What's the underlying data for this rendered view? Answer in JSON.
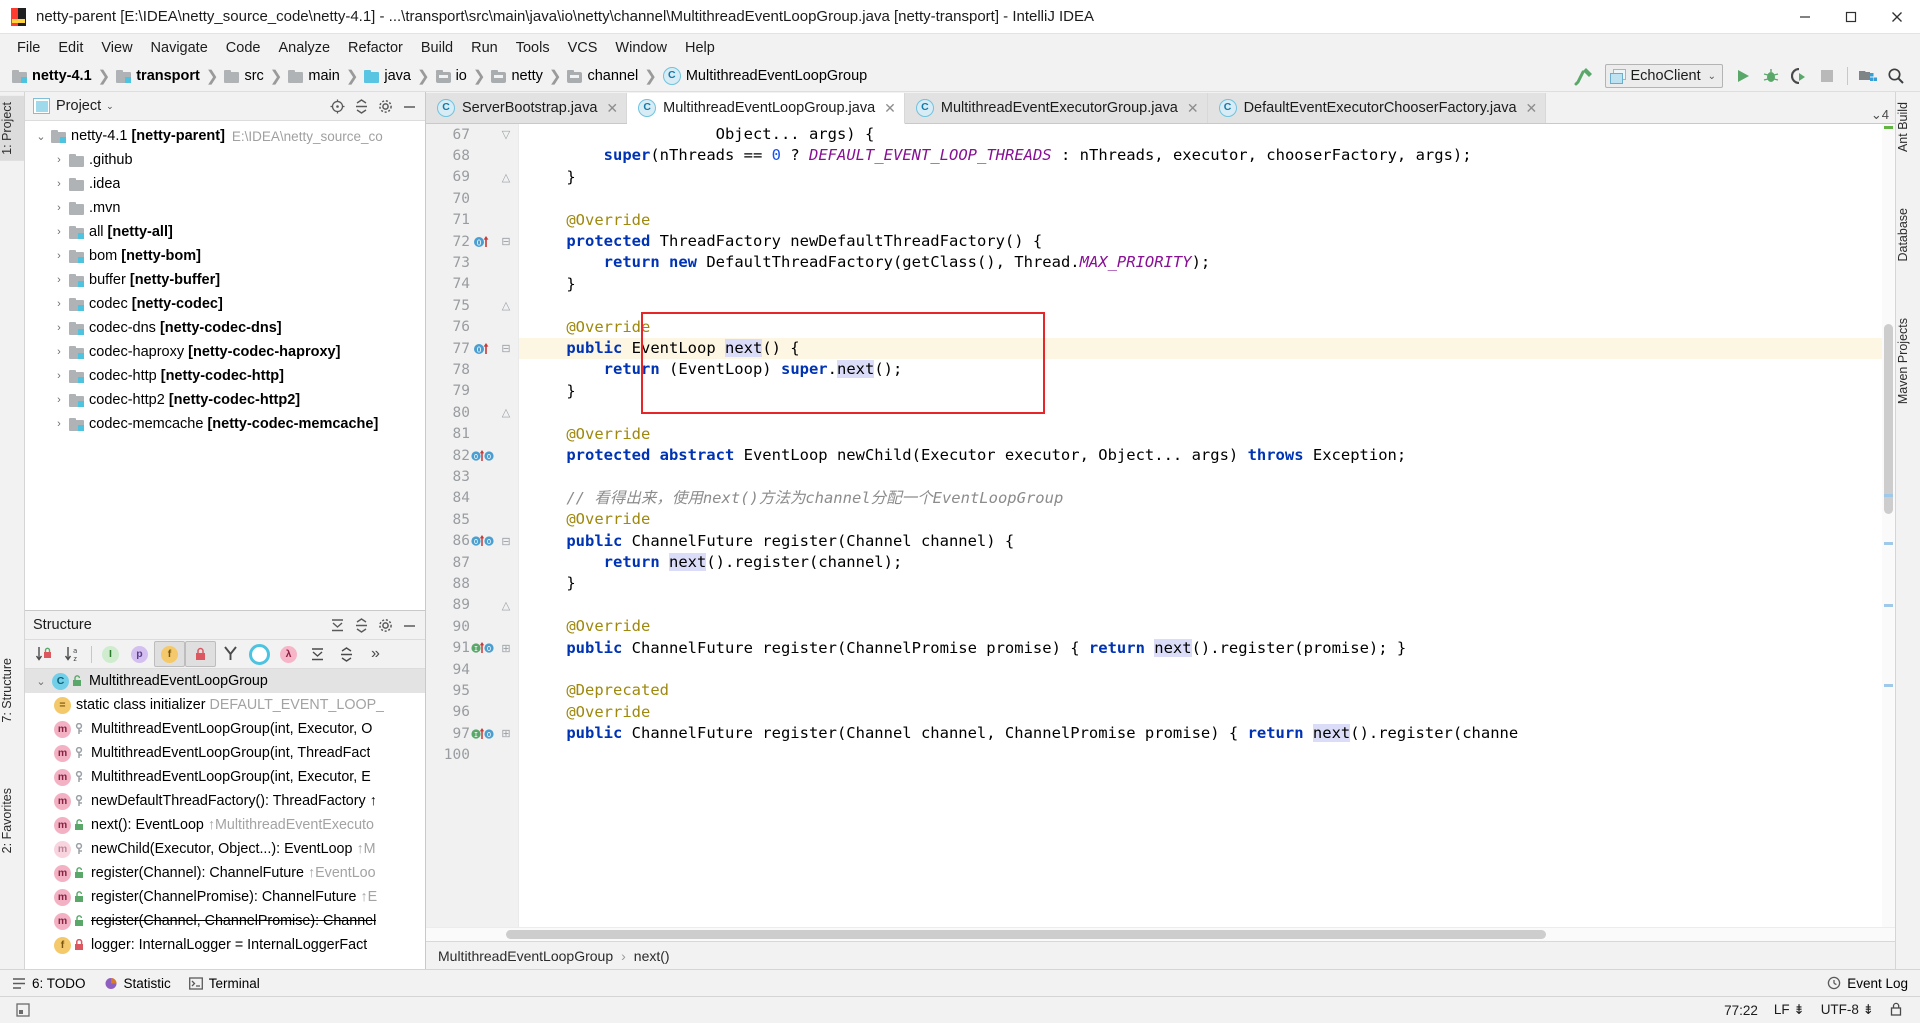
{
  "window": {
    "title": "netty-parent [E:\\IDEA\\netty_source_code\\netty-4.1] - ...\\transport\\src\\main\\java\\io\\netty\\channel\\MultithreadEventLoopGroup.java [netty-transport] - IntelliJ IDEA",
    "minimize": "–",
    "maximize": "□",
    "close": "✕"
  },
  "menu": [
    {
      "label": "File"
    },
    {
      "label": "Edit"
    },
    {
      "label": "View"
    },
    {
      "label": "Navigate"
    },
    {
      "label": "Code"
    },
    {
      "label": "Analyze"
    },
    {
      "label": "Refactor"
    },
    {
      "label": "Build"
    },
    {
      "label": "Run"
    },
    {
      "label": "Tools"
    },
    {
      "label": "VCS"
    },
    {
      "label": "Window"
    },
    {
      "label": "Help"
    }
  ],
  "breadcrumbs": [
    {
      "label": "netty-4.1",
      "icon": "module-folder-icon",
      "bold": true
    },
    {
      "label": "transport",
      "icon": "module-folder-icon",
      "bold": true
    },
    {
      "label": "src",
      "icon": "folder-icon",
      "bold": false
    },
    {
      "label": "main",
      "icon": "folder-icon",
      "bold": false
    },
    {
      "label": "java",
      "icon": "source-folder-icon",
      "bold": false
    },
    {
      "label": "io",
      "icon": "package-icon",
      "bold": false
    },
    {
      "label": "netty",
      "icon": "package-icon",
      "bold": false
    },
    {
      "label": "channel",
      "icon": "package-icon",
      "bold": false
    },
    {
      "label": "MultithreadEventLoopGroup",
      "icon": "class-icon",
      "bold": false
    }
  ],
  "toolbar": {
    "build_icon": "hammer-icon",
    "run_config": "EchoClient",
    "run_config_dropdown": "⌄",
    "run_icon": "run-icon",
    "debug_icon": "debug-icon",
    "run_coverage_icon": "run-with-coverage-icon",
    "stop_icon": "stop-icon",
    "project_structure_icon": "project-structure-icon",
    "search_icon": "search-everywhere-icon"
  },
  "left_rail": [
    {
      "label": "1: Project"
    },
    {
      "label": "7: Structure"
    },
    {
      "label": "2: Favorites"
    }
  ],
  "right_rail": [
    {
      "label": "Ant Build"
    },
    {
      "label": "Database"
    },
    {
      "label": "Maven Projects"
    }
  ],
  "project_panel": {
    "title": "Project",
    "caret": "⌄",
    "icons": [
      "target-icon",
      "collapse-all-icon",
      "settings-icon",
      "hide-icon"
    ],
    "tree": [
      {
        "arrow": "⌄",
        "icon": "module-folder-icon",
        "label": "netty-4.1",
        "bold_suffix": "[netty-parent]",
        "path": "E:\\IDEA\\netty_source_co",
        "indent": 0
      },
      {
        "arrow": "›",
        "icon": "folder-icon",
        "label": ".github",
        "bold_suffix": "",
        "path": "",
        "indent": 1
      },
      {
        "arrow": "›",
        "icon": "folder-icon",
        "label": ".idea",
        "bold_suffix": "",
        "path": "",
        "indent": 1
      },
      {
        "arrow": "›",
        "icon": "folder-icon",
        "label": ".mvn",
        "bold_suffix": "",
        "path": "",
        "indent": 1
      },
      {
        "arrow": "›",
        "icon": "module-folder-icon",
        "label": "all",
        "bold_suffix": "[netty-all]",
        "path": "",
        "indent": 1
      },
      {
        "arrow": "›",
        "icon": "module-folder-icon",
        "label": "bom",
        "bold_suffix": "[netty-bom]",
        "path": "",
        "indent": 1
      },
      {
        "arrow": "›",
        "icon": "module-folder-icon",
        "label": "buffer",
        "bold_suffix": "[netty-buffer]",
        "path": "",
        "indent": 1
      },
      {
        "arrow": "›",
        "icon": "module-folder-icon",
        "label": "codec",
        "bold_suffix": "[netty-codec]",
        "path": "",
        "indent": 1
      },
      {
        "arrow": "›",
        "icon": "module-folder-icon",
        "label": "codec-dns",
        "bold_suffix": "[netty-codec-dns]",
        "path": "",
        "indent": 1
      },
      {
        "arrow": "›",
        "icon": "module-folder-icon",
        "label": "codec-haproxy",
        "bold_suffix": "[netty-codec-haproxy]",
        "path": "",
        "indent": 1
      },
      {
        "arrow": "›",
        "icon": "module-folder-icon",
        "label": "codec-http",
        "bold_suffix": "[netty-codec-http]",
        "path": "",
        "indent": 1
      },
      {
        "arrow": "›",
        "icon": "module-folder-icon",
        "label": "codec-http2",
        "bold_suffix": "[netty-codec-http2]",
        "path": "",
        "indent": 1
      },
      {
        "arrow": "›",
        "icon": "module-folder-icon",
        "label": "codec-memcache",
        "bold_suffix": "[netty-codec-memcache]",
        "path": "",
        "indent": 1
      }
    ]
  },
  "structure_panel": {
    "title": "Structure",
    "toolbar_icons": [
      "sort-by-visibility-icon",
      "sort-alphabetically-icon",
      "show-inherited-icon",
      "show-properties-icon",
      "show-fields-icon",
      "show-non-public-icon",
      "show-anonymous-icon",
      "show-interfaces-icon",
      "show-lambdas-icon",
      "expand-all-icon",
      "collapse-all-icon",
      "more-icon"
    ],
    "items": [
      {
        "arrow": "⌄",
        "icon": "class-icon",
        "vis": "unlock-green-icon",
        "label": "MultithreadEventLoopGroup",
        "muted": "",
        "selected": true,
        "strike": false,
        "indent": 0
      },
      {
        "arrow": "",
        "icon": "static-init-icon",
        "vis": "",
        "label": "static class initializer",
        "muted": "DEFAULT_EVENT_LOOP_",
        "selected": false,
        "strike": false,
        "indent": 1
      },
      {
        "arrow": "",
        "icon": "method-icon",
        "vis": "key-icon",
        "label": "MultithreadEventLoopGroup(int, Executor, O",
        "muted": "",
        "selected": false,
        "strike": false,
        "indent": 1
      },
      {
        "arrow": "",
        "icon": "method-icon",
        "vis": "key-icon",
        "label": "MultithreadEventLoopGroup(int, ThreadFact",
        "muted": "",
        "selected": false,
        "strike": false,
        "indent": 1
      },
      {
        "arrow": "",
        "icon": "method-icon",
        "vis": "key-icon",
        "label": "MultithreadEventLoopGroup(int, Executor, E",
        "muted": "",
        "selected": false,
        "strike": false,
        "indent": 1
      },
      {
        "arrow": "",
        "icon": "method-icon",
        "vis": "key-icon",
        "label": "newDefaultThreadFactory(): ThreadFactory ↑",
        "muted": "",
        "selected": false,
        "strike": false,
        "indent": 1
      },
      {
        "arrow": "",
        "icon": "method-icon",
        "vis": "unlock-green-icon",
        "label": "next(): EventLoop",
        "muted": "↑MultithreadEventExecuto",
        "selected": false,
        "strike": false,
        "indent": 1
      },
      {
        "arrow": "",
        "icon": "method-abstract-icon",
        "vis": "key-icon",
        "label": "newChild(Executor, Object...): EventLoop",
        "muted": "↑M",
        "selected": false,
        "strike": false,
        "indent": 1
      },
      {
        "arrow": "",
        "icon": "method-icon",
        "vis": "unlock-green-icon",
        "label": "register(Channel): ChannelFuture",
        "muted": "↑EventLoo",
        "selected": false,
        "strike": false,
        "indent": 1
      },
      {
        "arrow": "",
        "icon": "method-icon",
        "vis": "unlock-green-icon",
        "label": "register(ChannelPromise): ChannelFuture",
        "muted": "↑E",
        "selected": false,
        "strike": false,
        "indent": 1
      },
      {
        "arrow": "",
        "icon": "method-icon",
        "vis": "unlock-green-icon",
        "label": "register(Channel, ChannelPromise): Channel",
        "muted": "",
        "selected": false,
        "strike": true,
        "indent": 1
      },
      {
        "arrow": "",
        "icon": "field-static-icon",
        "vis": "lock-icon",
        "label": "logger: InternalLogger = InternalLoggerFact",
        "muted": "",
        "selected": false,
        "strike": false,
        "indent": 1
      }
    ]
  },
  "editor_tabs": [
    {
      "label": "ServerBootstrap.java",
      "icon": "java-class-icon",
      "active": false,
      "close": "✕"
    },
    {
      "label": "MultithreadEventLoopGroup.java",
      "icon": "java-class-icon",
      "active": true,
      "close": "✕"
    },
    {
      "label": "MultithreadEventExecutorGroup.java",
      "icon": "java-class-icon",
      "active": false,
      "close": "✕"
    },
    {
      "label": "DefaultEventExecutorChooserFactory.java",
      "icon": "java-class-icon",
      "active": false,
      "close": "✕"
    }
  ],
  "tab_overflow": "⌄4",
  "editor": {
    "cursor_line": 77,
    "highlight_box_lines": [
      76,
      79
    ],
    "lines": [
      {
        "num": "67",
        "text": "                    Object... args) {",
        "marks": [],
        "fold": "fold-end"
      },
      {
        "num": "68",
        "text": "        super(nThreads == 0 ? DEFAULT_EVENT_LOOP_THREADS : nThreads, executor, chooserFactory, args);",
        "marks": [],
        "fold": ""
      },
      {
        "num": "69",
        "text": "    }",
        "marks": [],
        "fold": "fold-close"
      },
      {
        "num": "70",
        "text": "",
        "marks": [],
        "fold": ""
      },
      {
        "num": "71",
        "text": "    @Override",
        "marks": [],
        "fold": ""
      },
      {
        "num": "72",
        "text": "    protected ThreadFactory newDefaultThreadFactory() {",
        "marks": [
          "override-up"
        ],
        "fold": "fold-open"
      },
      {
        "num": "73",
        "text": "        return new DefaultThreadFactory(getClass(), Thread.MAX_PRIORITY);",
        "marks": [],
        "fold": ""
      },
      {
        "num": "74",
        "text": "    }",
        "marks": [],
        "fold": ""
      },
      {
        "num": "75",
        "text": "",
        "marks": [],
        "fold": "fold-close"
      },
      {
        "num": "76",
        "text": "    @Override",
        "marks": [],
        "fold": ""
      },
      {
        "num": "77",
        "text": "    public EventLoop next() {",
        "marks": [
          "override-up",
          "bulb"
        ],
        "fold": "fold-open"
      },
      {
        "num": "78",
        "text": "        return (EventLoop) super.next();",
        "marks": [],
        "fold": ""
      },
      {
        "num": "79",
        "text": "    }",
        "marks": [],
        "fold": ""
      },
      {
        "num": "80",
        "text": "",
        "marks": [],
        "fold": "fold-close"
      },
      {
        "num": "81",
        "text": "    @Override",
        "marks": [],
        "fold": ""
      },
      {
        "num": "82",
        "text": "    protected abstract EventLoop newChild(Executor executor, Object... args) throws Exception;",
        "marks": [
          "override-up",
          "impl-down"
        ],
        "fold": ""
      },
      {
        "num": "83",
        "text": "",
        "marks": [],
        "fold": ""
      },
      {
        "num": "84",
        "text": "    // 看得出来，使用next()方法为channel分配一个EventLoopGroup",
        "marks": [],
        "fold": ""
      },
      {
        "num": "85",
        "text": "    @Override",
        "marks": [],
        "fold": ""
      },
      {
        "num": "86",
        "text": "    public ChannelFuture register(Channel channel) {",
        "marks": [
          "override-up",
          "impl-down"
        ],
        "fold": "fold-open"
      },
      {
        "num": "87",
        "text": "        return next().register(channel);",
        "marks": [],
        "fold": ""
      },
      {
        "num": "88",
        "text": "    }",
        "marks": [],
        "fold": ""
      },
      {
        "num": "89",
        "text": "",
        "marks": [],
        "fold": "fold-close"
      },
      {
        "num": "90",
        "text": "    @Override",
        "marks": [],
        "fold": ""
      },
      {
        "num": "91",
        "text": "    public ChannelFuture register(ChannelPromise promise) { return next().register(promise); }",
        "marks": [
          "override-up",
          "impl-down"
        ],
        "fold": "fold-collapsed"
      },
      {
        "num": "94",
        "text": "",
        "marks": [],
        "fold": ""
      },
      {
        "num": "95",
        "text": "    @Deprecated",
        "marks": [],
        "fold": ""
      },
      {
        "num": "96",
        "text": "    @Override",
        "marks": [],
        "fold": ""
      },
      {
        "num": "97",
        "text": "    public ChannelFuture register(Channel channel, ChannelPromise promise) { return next().register(channe",
        "marks": [
          "override-up",
          "impl-down"
        ],
        "fold": "fold-collapsed"
      },
      {
        "num": "100",
        "text": "",
        "marks": [],
        "fold": ""
      }
    ]
  },
  "editor_breadcrumb": {
    "class": "MultithreadEventLoopGroup",
    "separator": "›",
    "method": "next()"
  },
  "bottom_tools": [
    {
      "label": "6: TODO",
      "icon": "todo-icon",
      "underline": "6"
    },
    {
      "label": "Statistic",
      "icon": "statistic-icon",
      "underline": ""
    },
    {
      "label": "Terminal",
      "icon": "terminal-icon",
      "underline": ""
    }
  ],
  "event_log": {
    "label": "Event Log",
    "icon": "event-log-icon"
  },
  "status_right": [
    {
      "label": "77:22"
    },
    {
      "label": "LF ⇟"
    },
    {
      "label": "UTF-8 ⇟"
    },
    {
      "label": "lock-icon"
    }
  ],
  "colors": {
    "accent_blue": "#0033b3",
    "annotation": "#9e880d",
    "comment_gray": "#8c8c8c",
    "static_field": "#871094",
    "number": "#1750eb",
    "highlight_box": "#e8262a",
    "caret_line": "#fcf6e3",
    "selection": "#dbdcf8",
    "panel_bg": "#f2f2f2",
    "editor_bg": "#ffffff"
  }
}
